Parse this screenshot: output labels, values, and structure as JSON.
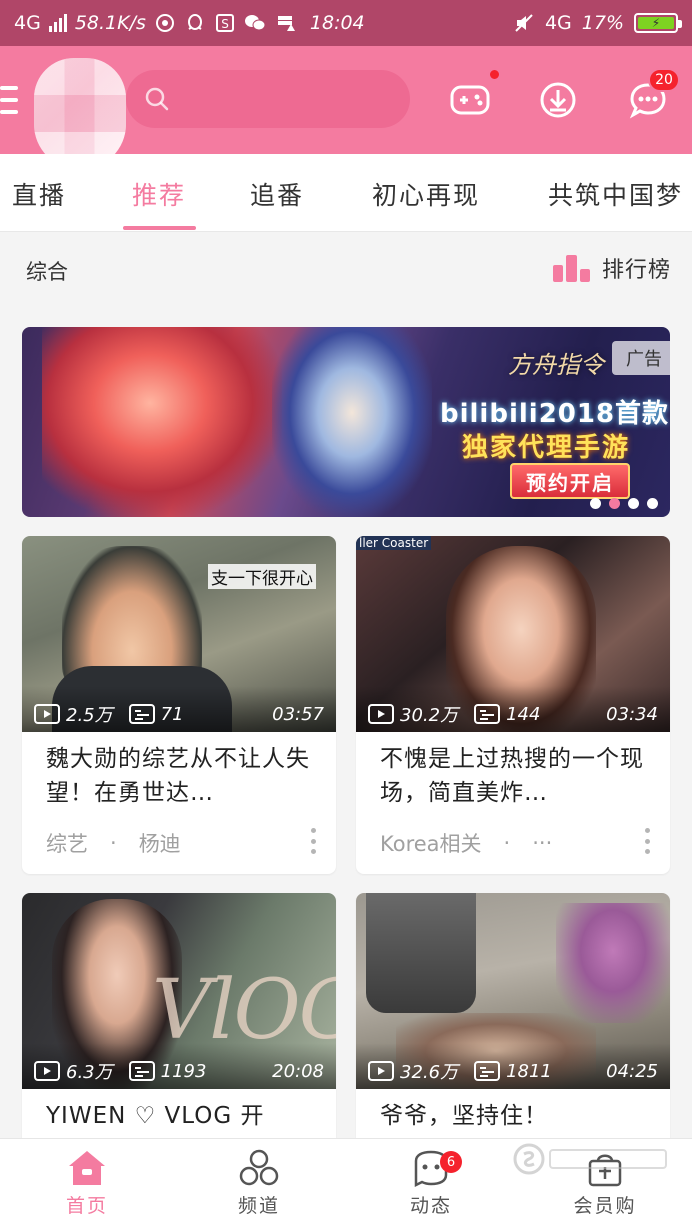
{
  "status_bar": {
    "network": "4G",
    "speed": "58.1K/s",
    "time": "18:04",
    "network_right": "4G",
    "battery": "17%"
  },
  "header": {
    "search_placeholder": ""
  },
  "badges": {
    "messages": "20",
    "dynamic": "6"
  },
  "tabs": [
    {
      "label": "直播"
    },
    {
      "label": "推荐"
    },
    {
      "label": "追番"
    },
    {
      "label": "初心再现"
    },
    {
      "label": "共筑中国梦"
    }
  ],
  "section": {
    "title": "综合",
    "ranking": "排行榜"
  },
  "banner": {
    "logo": "方舟指令",
    "line1": "bilibili2018首款",
    "line2": "独家代理手游",
    "cta": "预约开启",
    "ad_label": "广告"
  },
  "cards": [
    {
      "views": "2.5万",
      "danmaku": "71",
      "duration": "03:57",
      "overlay": "支一下很开心",
      "title": "魏大勋的综艺从不让人失望！在勇世达…",
      "tag1": "综艺",
      "tag2": "杨迪"
    },
    {
      "views": "30.2万",
      "danmaku": "144",
      "duration": "03:34",
      "overlay": "ller Coaster",
      "title": "不愧是上过热搜的一个现场，简直美炸…",
      "tag1": "Korea相关",
      "tag2": "···"
    },
    {
      "views": "6.3万",
      "danmaku": "1193",
      "duration": "20:08",
      "overlay": "VlOG",
      "title": "YIWEN ♡ VLOG 开",
      "tag1": "",
      "tag2": ""
    },
    {
      "views": "32.6万",
      "danmaku": "1811",
      "duration": "04:25",
      "overlay": "",
      "title": "爷爷，坚持住！",
      "tag1": "",
      "tag2": ""
    }
  ],
  "bottom_nav": [
    {
      "label": "首页"
    },
    {
      "label": "频道"
    },
    {
      "label": "动态"
    },
    {
      "label": "会员购"
    }
  ],
  "colors": {
    "brand_pink": "#f47ba0",
    "status_bar": "#b04668",
    "badge_red": "#f5222d"
  },
  "icons": [
    "menu-icon",
    "search-icon",
    "gamepad-icon",
    "download-icon",
    "message-icon",
    "play-icon",
    "danmaku-icon",
    "home-icon",
    "channel-icon",
    "dynamic-icon",
    "shop-icon"
  ]
}
